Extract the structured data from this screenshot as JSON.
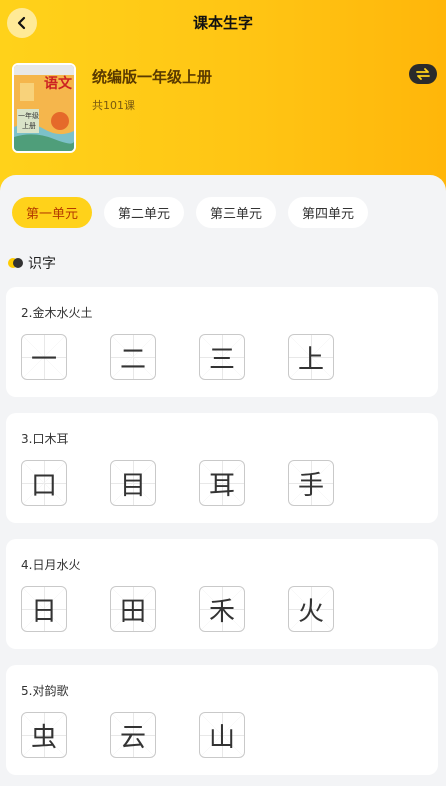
{
  "header": {
    "title": "课本生字",
    "book_title": "统编版一年级上册",
    "lesson_count": "共101课",
    "cover": {
      "label": "语文",
      "grade": "一年级",
      "volume": "上册"
    }
  },
  "tabs": [
    {
      "label": "第一单元",
      "active": true
    },
    {
      "label": "第二单元",
      "active": false
    },
    {
      "label": "第三单元",
      "active": false
    },
    {
      "label": "第四单元",
      "active": false
    }
  ],
  "section": {
    "label": "识字"
  },
  "lessons": [
    {
      "title": "2.金木水火土",
      "chars": [
        "一",
        "二",
        "三",
        "上"
      ]
    },
    {
      "title": "3.口木耳",
      "chars": [
        "口",
        "目",
        "耳",
        "手"
      ]
    },
    {
      "title": "4.日月水火",
      "chars": [
        "日",
        "田",
        "禾",
        "火"
      ]
    },
    {
      "title": "5.对韵歌",
      "chars": [
        "虫",
        "云",
        "山"
      ]
    }
  ],
  "colors": {
    "accent": "#ffd21a",
    "active_tab_text": "#b33a00"
  }
}
